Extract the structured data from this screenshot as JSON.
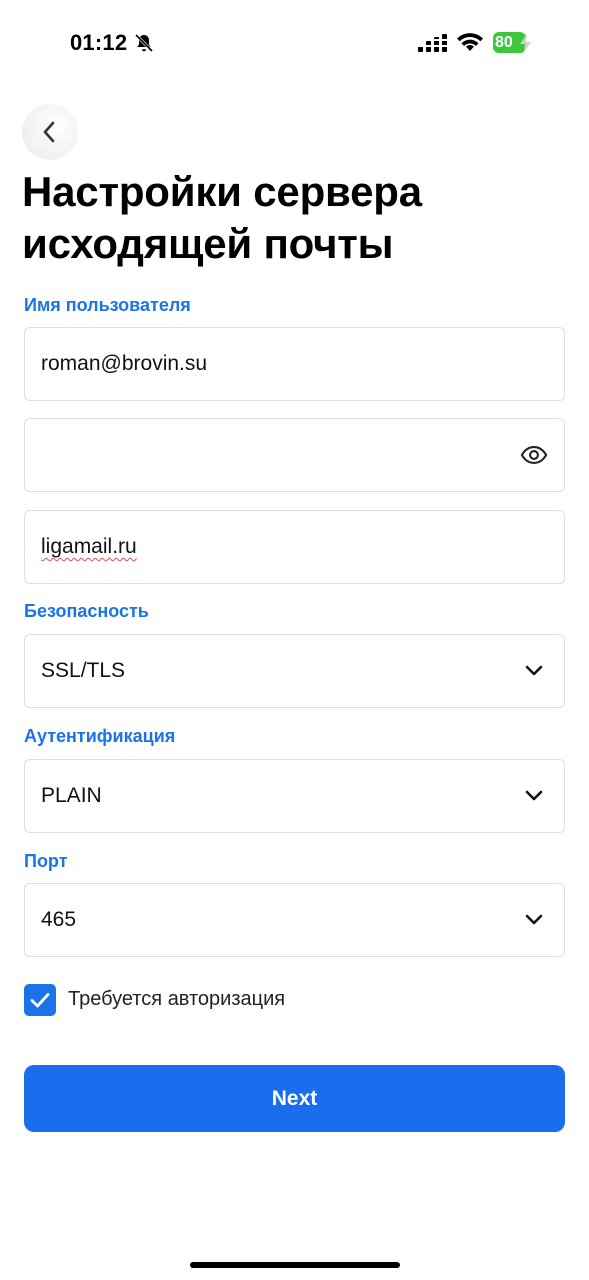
{
  "status_bar": {
    "time": "01:12",
    "battery_level": "80",
    "icons": [
      "bell-slash-icon",
      "signal-icon",
      "wifi-icon",
      "battery-icon"
    ]
  },
  "header": {
    "back_icon": "chevron-left-icon",
    "title": "Настройки сервера исходящей почты"
  },
  "form": {
    "username_label": "Имя пользователя",
    "username_value": "roman@brovin.su",
    "password_value": "",
    "password_icon": "eye-icon",
    "server_value": "ligamail.ru",
    "security_label": "Безопасность",
    "security_value": "SSL/TLS",
    "auth_label": "Аутентификация",
    "auth_value": "PLAIN",
    "port_label": "Порт",
    "port_value": "465",
    "requires_auth_label": "Требуется авторизация",
    "requires_auth_checked": true
  },
  "actions": {
    "next_label": "Next"
  },
  "colors": {
    "accent": "#1a73e8",
    "button": "#1a6ded",
    "battery": "#3ec63e"
  }
}
